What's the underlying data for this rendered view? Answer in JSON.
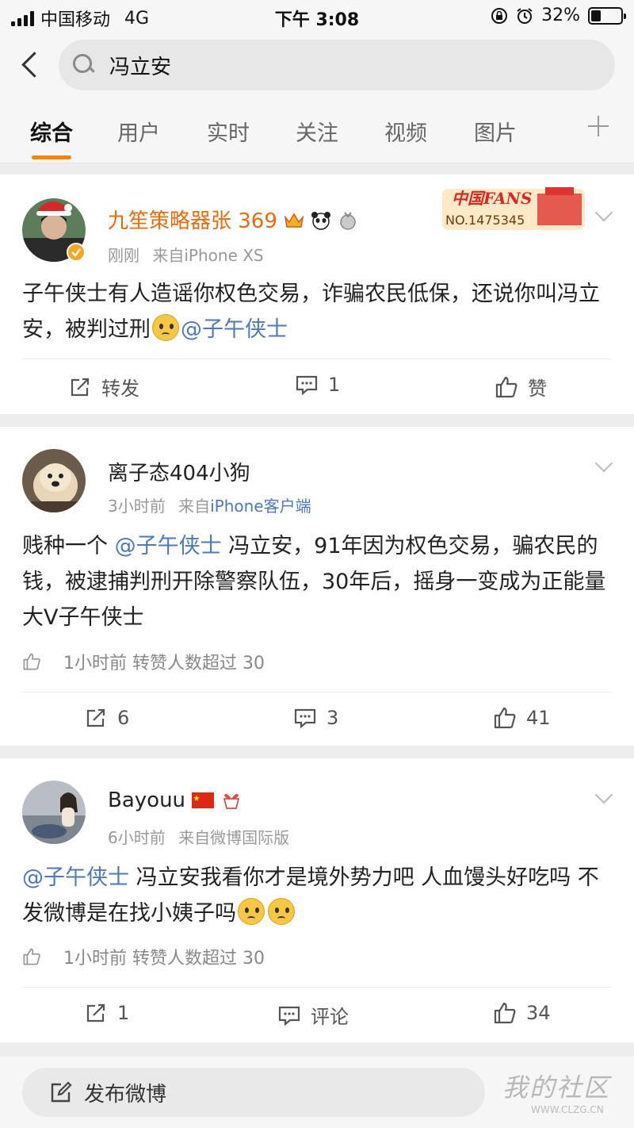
{
  "status": {
    "carrier": "中国移动",
    "network": "4G",
    "time": "下午 3:08",
    "battery": "32%",
    "battery_level": 0.32
  },
  "search": {
    "query": "冯立安"
  },
  "tabs": [
    "综合",
    "用户",
    "实时",
    "关注",
    "视频",
    "图片"
  ],
  "posts": [
    {
      "username": "九笙策略器张 369",
      "time": "刚刚",
      "source_prefix": "来自",
      "source": "iPhone XS",
      "fans_badge_top": "中国FANS",
      "fans_badge_no": "NO.1475345",
      "body_text": "子午侠士有人造谣你权色交易，诈骗农民低保，还说你叫冯立安，被判过刑",
      "mention": "@子午侠士",
      "repost_label": "转发",
      "comment_count": "1",
      "like_label": "赞"
    },
    {
      "username": "离子态404小狗",
      "time": "3小时前",
      "source_prefix": "来自",
      "source": "iPhone客户端",
      "body_before": "贱种一个",
      "mention": "@子午侠士",
      "body_after": "冯立安，91年因为权色交易，骗农民的钱，被逮捕判刑开除警察队伍，30年后，摇身一变成为正能量大V子午侠士",
      "like_time": "1小时前",
      "like_note": "转赞人数超过 30",
      "repost_count": "6",
      "comment_count": "3",
      "like_count": "41"
    },
    {
      "username": "Bayouu",
      "time": "6小时前",
      "source_prefix": "来自",
      "source": "微博国际版",
      "mention": "@子午侠士",
      "body_after": "冯立安我看你才是境外势力吧  人血馒头好吃吗  不发微博是在找小姨子吗",
      "like_time": "1小时前",
      "like_note": "转赞人数超过 30",
      "repost_count": "1",
      "comment_label": "评论",
      "like_count": "34"
    }
  ],
  "compose": {
    "label": "发布微博"
  },
  "watermark": {
    "text": "我的社区",
    "url": "WWW.CLZG.CN"
  },
  "colors": {
    "accent": "#ff8200",
    "link": "#4e7ab5",
    "vip_name": "#e86b0c"
  }
}
